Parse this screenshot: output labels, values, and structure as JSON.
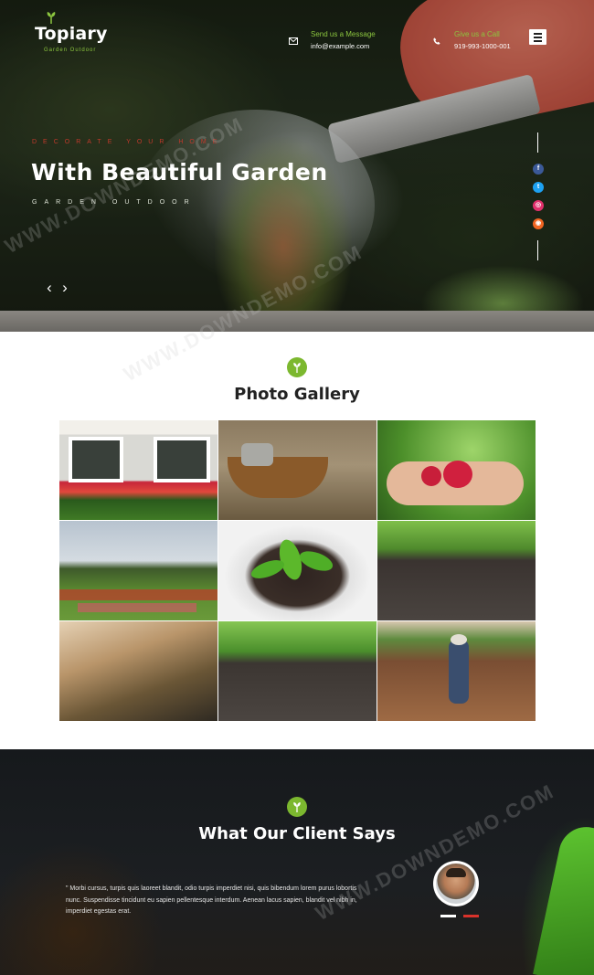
{
  "brand": {
    "name": "Topiary",
    "tagline": "Garden Outdoor",
    "accent": "#8cc63f"
  },
  "header": {
    "message": {
      "label": "Send us a Message",
      "value": "info@example.com",
      "icon": "envelope-icon"
    },
    "call": {
      "label": "Give us a Call",
      "value": "919-993-1000-001",
      "icon": "phone-icon"
    },
    "menu_icon": "hamburger-menu-icon"
  },
  "hero": {
    "kicker": "DECORATE YOUR HOME",
    "title": "With Beautiful Garden",
    "subtitle": "GARDEN OUTDOOR",
    "prev_arrow": "‹",
    "next_arrow": "›",
    "social": [
      {
        "name": "facebook",
        "glyph": "f",
        "color": "#3b5998"
      },
      {
        "name": "twitter",
        "glyph": "t",
        "color": "#1da1f2"
      },
      {
        "name": "instagram",
        "glyph": "◎",
        "color": "#e1306c"
      },
      {
        "name": "rss",
        "glyph": "◉",
        "color": "#f26522"
      }
    ]
  },
  "gallery": {
    "title": "Photo Gallery",
    "images": [
      "cottage windows with flower boxes",
      "wicker basket with watering can",
      "hand holding radishes",
      "formal garden with flower beds",
      "seedling in soil",
      "sprouts in soil",
      "terrarium workshop",
      "sprouts in soil close-up",
      "gardener watering field"
    ]
  },
  "testimonials": {
    "title": "What Our Client Says",
    "quote": "\" Morbi cursus, turpis quis laoreet blandit, odio turpis imperdiet nisi, quis bibendum lorem purus lobortis nunc. Suspendisse tincidunt eu sapien pellentesque interdum. Aenean lacus sapien, blandit vel nibh in, imperdiet egestas erat.",
    "dots": [
      {
        "state": "inactive",
        "color": "#ffffff"
      },
      {
        "state": "active",
        "color": "#d9322b"
      }
    ]
  },
  "watermark": "WWW.DOWNDEMO.COM"
}
